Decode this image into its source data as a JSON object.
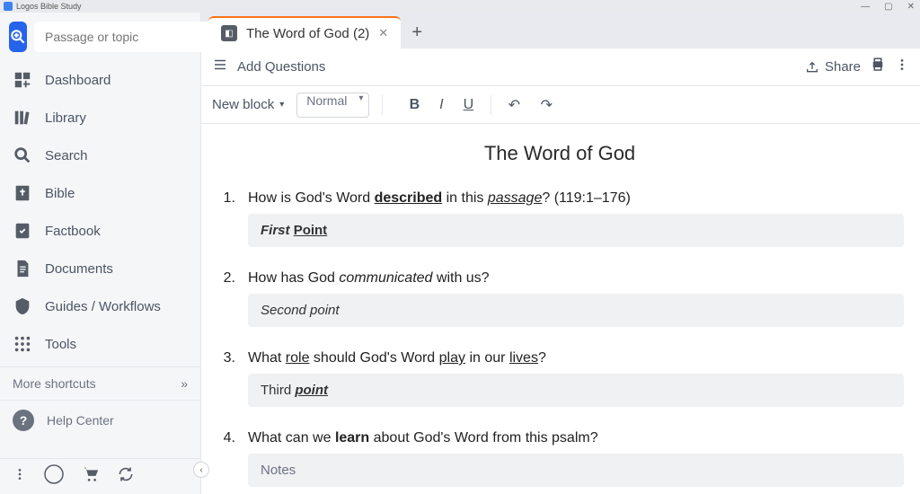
{
  "titlebar": {
    "app_name": "Logos Bible Study"
  },
  "sidebar": {
    "search_placeholder": "Passage or topic",
    "items": [
      {
        "label": "Dashboard",
        "icon": "dashboard-icon"
      },
      {
        "label": "Library",
        "icon": "library-icon"
      },
      {
        "label": "Search",
        "icon": "search-icon"
      },
      {
        "label": "Bible",
        "icon": "bible-icon"
      },
      {
        "label": "Factbook",
        "icon": "factbook-icon"
      },
      {
        "label": "Documents",
        "icon": "documents-icon"
      },
      {
        "label": "Guides / Workflows",
        "icon": "guides-icon"
      },
      {
        "label": "Tools",
        "icon": "tools-icon"
      }
    ],
    "more": "More shortcuts",
    "help": "Help Center"
  },
  "tabs": {
    "active": {
      "label": "The Word of God (2)"
    }
  },
  "toolbar": {
    "add_questions": "Add Questions",
    "share": "Share",
    "new_block": "New block",
    "style": "Normal"
  },
  "document": {
    "title": "The Word of God",
    "questions": [
      {
        "num": "1.",
        "text_parts": [
          "How is God's Word ",
          "described",
          " in this ",
          "passage",
          "? (119:1–176)"
        ],
        "answer_parts": [
          "First",
          " ",
          "Point"
        ]
      },
      {
        "num": "2.",
        "text_parts": [
          "How has God ",
          "communicated",
          " with us?"
        ],
        "answer_parts": [
          "Second point"
        ]
      },
      {
        "num": "3.",
        "text_parts": [
          "What ",
          "role",
          " should God's Word ",
          "play",
          " in our ",
          "lives",
          "?"
        ],
        "answer_parts": [
          "Third ",
          "point"
        ]
      },
      {
        "num": "4.",
        "text_parts": [
          "What can we ",
          "learn",
          " about God's Word from this psalm?"
        ],
        "answer_parts": [
          "Notes"
        ]
      }
    ]
  }
}
